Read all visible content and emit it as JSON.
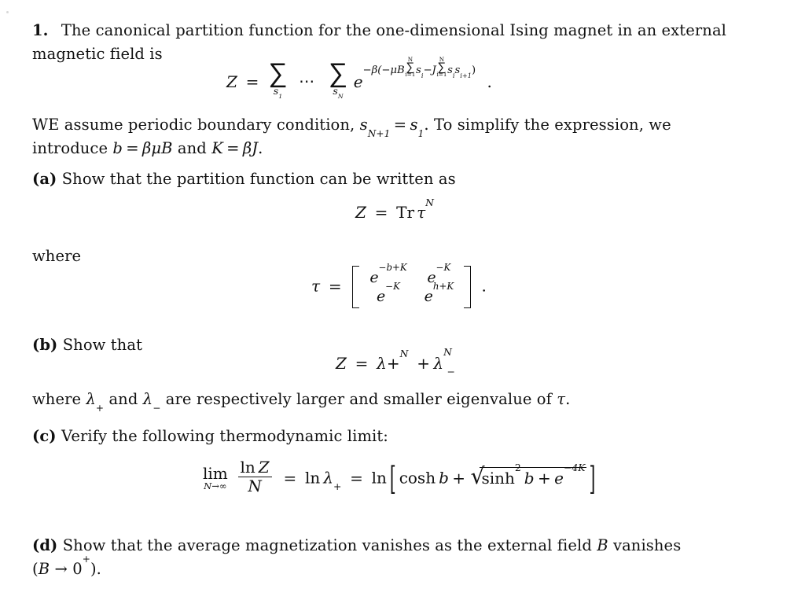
{
  "document": {
    "type": "physics-problem-set",
    "background_color": "#ffffff",
    "text_color": "#111111"
  },
  "problem": {
    "number": "1.",
    "intro_line1": "The canonical partition function for the one-dimensional Ising magnet in an external",
    "intro_line2": "magnetic field is"
  },
  "equation_partition": {
    "lhs": "Z",
    "equals": "=",
    "sum1_symbol": "∑",
    "sum1_limit": "s",
    "sum1_limit_sub": "1",
    "ellipsis": "⋯",
    "sum2_symbol": "∑",
    "sum2_limit": "s",
    "sum2_limit_sub": "N",
    "exp_base": "e",
    "exp_minus_beta": "−β(−",
    "exp_mu": "μ",
    "exp_B": "B",
    "inner_sum_symbol": "∑",
    "inner_sum_upper": "N",
    "inner_sum_lower": "i=1",
    "exp_s_i": "s",
    "exp_s_i_sub": "i",
    "exp_minus_J": "−J",
    "inner_sum2_symbol": "∑",
    "inner_sum2_upper": "N",
    "inner_sum2_lower": "i=1",
    "exp_s_i_s": "s",
    "exp_s_i_s_sub": "i",
    "exp_s_ip1": "s",
    "exp_s_ip1_sub": "i+1",
    "exp_close": ")",
    "period": "."
  },
  "boundary": {
    "line1_a": "WE assume periodic boundary condition, ",
    "s_sym": "s",
    "s_sub": "N+1",
    "eq": "=",
    "s1_sym": "s",
    "s1_sub": "1",
    "line1_b": ". To simplify the expression, we",
    "line2_a": "introduce ",
    "b_sym": "b",
    "b_eq": "=",
    "b_val_beta": "β",
    "b_val_mu": "μ",
    "b_val_B": "B",
    "and_text": " and ",
    "K_sym": "K",
    "K_eq": "=",
    "K_val_beta": "β",
    "K_val_J": "J",
    "period": "."
  },
  "part_a": {
    "label": "(a)",
    "text": "Show that the partition function can be written as",
    "equation": {
      "Z": "Z",
      "equals": "=",
      "Tr": "Tr",
      "tau": "τ",
      "power": "N"
    },
    "where_label": "where",
    "matrix_equation": {
      "tau": "τ",
      "equals": "=",
      "cells": [
        [
          {
            "base": "e",
            "exp": "−b+K"
          },
          {
            "base": "e",
            "exp": "−K"
          }
        ],
        [
          {
            "base": "e",
            "exp": "−K"
          },
          {
            "base": "e",
            "exp": "h+K"
          }
        ]
      ],
      "period": "."
    }
  },
  "part_b": {
    "label": "(b)",
    "text": "Show that",
    "equation": {
      "Z": "Z",
      "equals": "=",
      "lambda": "λ",
      "plus_sub": "+",
      "power_first": "N",
      "plus_op": "+",
      "lambda2": "λ",
      "minus_sub": "−",
      "power_second": "N"
    },
    "where_line": {
      "prefix": "where ",
      "lambda_plus": "λ",
      "plus_sub": "+",
      "mid": " and ",
      "lambda_minus": "λ",
      "minus_sub": "−",
      "suffix": " are respectively larger and smaller eigenvalue of ",
      "tau": "τ",
      "period": "."
    }
  },
  "part_c": {
    "label": "(c)",
    "text": "Verify the following thermodynamic limit:",
    "equation": {
      "lim_word": "lim",
      "lim_sub": "N→∞",
      "frac_num_ln": "ln",
      "frac_num_Z": "Z",
      "frac_den": "N",
      "equals1": "=",
      "ln1": "ln",
      "lambda": "λ",
      "lambda_sub": "+",
      "equals2": "=",
      "ln2": "ln",
      "bracket_open": "[",
      "cosh": "cosh",
      "cosh_arg": "b",
      "plus": "+",
      "radical": "√",
      "sinh": "sinh",
      "sinh_power": "2",
      "sinh_arg": "b",
      "plus2": "+",
      "e_base": "e",
      "e_exp": "−4K",
      "bracket_close": "]"
    }
  },
  "part_d": {
    "label": "(d)",
    "line1_a": "Show that the average magnetization vanishes as the external field ",
    "B_sym": "B",
    "line1_b": " vanishes",
    "line2_open": "(",
    "line2_B": "B",
    "line2_arrow": " → 0",
    "line2_plus": "+",
    "line2_close": ")",
    "line2_period": "."
  }
}
